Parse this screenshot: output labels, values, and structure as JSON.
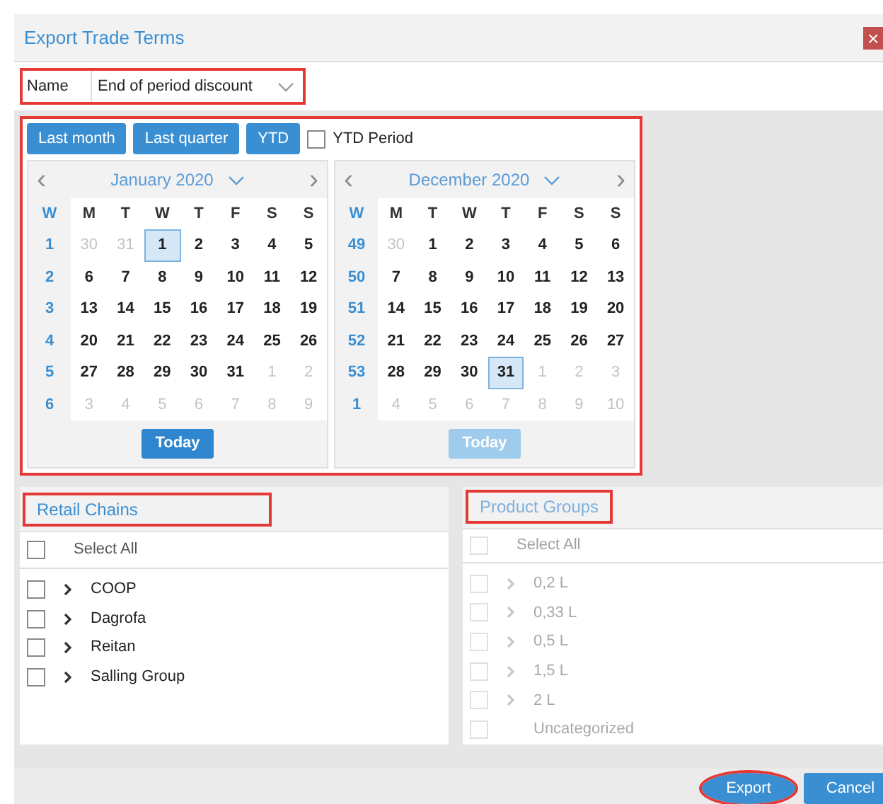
{
  "dialog": {
    "title": "Export Trade Terms",
    "close": "×"
  },
  "name_field": {
    "label": "Name",
    "value": "End of period discount",
    "annotated": true
  },
  "period": {
    "annotated": true,
    "buttons": [
      {
        "label": "Last month"
      },
      {
        "label": "Last quarter"
      },
      {
        "label": "YTD"
      }
    ],
    "ytd_period": {
      "label": "YTD Period",
      "checked": false
    },
    "calendars": [
      {
        "title": "January 2020",
        "prev": "‹",
        "next": "›",
        "week_header": "W",
        "weekdays": [
          "M",
          "T",
          "W",
          "T",
          "F",
          "S",
          "S"
        ],
        "today": {
          "label": "Today",
          "disabled": false
        },
        "weeks": [
          {
            "week": "1",
            "days": [
              {
                "d": "30",
                "other": true,
                "selected": false
              },
              {
                "d": "31",
                "other": true,
                "selected": false
              },
              {
                "d": "1",
                "other": false,
                "selected": true
              },
              {
                "d": "2",
                "other": false,
                "selected": false
              },
              {
                "d": "3",
                "other": false,
                "selected": false
              },
              {
                "d": "4",
                "other": false,
                "selected": false
              },
              {
                "d": "5",
                "other": false,
                "selected": false
              }
            ]
          },
          {
            "week": "2",
            "days": [
              {
                "d": "6",
                "other": false,
                "selected": false
              },
              {
                "d": "7",
                "other": false,
                "selected": false
              },
              {
                "d": "8",
                "other": false,
                "selected": false
              },
              {
                "d": "9",
                "other": false,
                "selected": false
              },
              {
                "d": "10",
                "other": false,
                "selected": false
              },
              {
                "d": "11",
                "other": false,
                "selected": false
              },
              {
                "d": "12",
                "other": false,
                "selected": false
              }
            ]
          },
          {
            "week": "3",
            "days": [
              {
                "d": "13",
                "other": false,
                "selected": false
              },
              {
                "d": "14",
                "other": false,
                "selected": false
              },
              {
                "d": "15",
                "other": false,
                "selected": false
              },
              {
                "d": "16",
                "other": false,
                "selected": false
              },
              {
                "d": "17",
                "other": false,
                "selected": false
              },
              {
                "d": "18",
                "other": false,
                "selected": false
              },
              {
                "d": "19",
                "other": false,
                "selected": false
              }
            ]
          },
          {
            "week": "4",
            "days": [
              {
                "d": "20",
                "other": false,
                "selected": false
              },
              {
                "d": "21",
                "other": false,
                "selected": false
              },
              {
                "d": "22",
                "other": false,
                "selected": false
              },
              {
                "d": "23",
                "other": false,
                "selected": false
              },
              {
                "d": "24",
                "other": false,
                "selected": false
              },
              {
                "d": "25",
                "other": false,
                "selected": false
              },
              {
                "d": "26",
                "other": false,
                "selected": false
              }
            ]
          },
          {
            "week": "5",
            "days": [
              {
                "d": "27",
                "other": false,
                "selected": false
              },
              {
                "d": "28",
                "other": false,
                "selected": false
              },
              {
                "d": "29",
                "other": false,
                "selected": false
              },
              {
                "d": "30",
                "other": false,
                "selected": false
              },
              {
                "d": "31",
                "other": false,
                "selected": false
              },
              {
                "d": "1",
                "other": true,
                "selected": false
              },
              {
                "d": "2",
                "other": true,
                "selected": false
              }
            ]
          },
          {
            "week": "6",
            "days": [
              {
                "d": "3",
                "other": true,
                "selected": false
              },
              {
                "d": "4",
                "other": true,
                "selected": false
              },
              {
                "d": "5",
                "other": true,
                "selected": false
              },
              {
                "d": "6",
                "other": true,
                "selected": false
              },
              {
                "d": "7",
                "other": true,
                "selected": false
              },
              {
                "d": "8",
                "other": true,
                "selected": false
              },
              {
                "d": "9",
                "other": true,
                "selected": false
              }
            ]
          }
        ]
      },
      {
        "title": "December 2020",
        "prev": "‹",
        "next": "›",
        "week_header": "W",
        "weekdays": [
          "M",
          "T",
          "W",
          "T",
          "F",
          "S",
          "S"
        ],
        "today": {
          "label": "Today",
          "disabled": true
        },
        "weeks": [
          {
            "week": "49",
            "days": [
              {
                "d": "30",
                "other": true,
                "selected": false
              },
              {
                "d": "1",
                "other": false,
                "selected": false
              },
              {
                "d": "2",
                "other": false,
                "selected": false
              },
              {
                "d": "3",
                "other": false,
                "selected": false
              },
              {
                "d": "4",
                "other": false,
                "selected": false
              },
              {
                "d": "5",
                "other": false,
                "selected": false
              },
              {
                "d": "6",
                "other": false,
                "selected": false
              }
            ]
          },
          {
            "week": "50",
            "days": [
              {
                "d": "7",
                "other": false,
                "selected": false
              },
              {
                "d": "8",
                "other": false,
                "selected": false
              },
              {
                "d": "9",
                "other": false,
                "selected": false
              },
              {
                "d": "10",
                "other": false,
                "selected": false
              },
              {
                "d": "11",
                "other": false,
                "selected": false
              },
              {
                "d": "12",
                "other": false,
                "selected": false
              },
              {
                "d": "13",
                "other": false,
                "selected": false
              }
            ]
          },
          {
            "week": "51",
            "days": [
              {
                "d": "14",
                "other": false,
                "selected": false
              },
              {
                "d": "15",
                "other": false,
                "selected": false
              },
              {
                "d": "16",
                "other": false,
                "selected": false
              },
              {
                "d": "17",
                "other": false,
                "selected": false
              },
              {
                "d": "18",
                "other": false,
                "selected": false
              },
              {
                "d": "19",
                "other": false,
                "selected": false
              },
              {
                "d": "20",
                "other": false,
                "selected": false
              }
            ]
          },
          {
            "week": "52",
            "days": [
              {
                "d": "21",
                "other": false,
                "selected": false
              },
              {
                "d": "22",
                "other": false,
                "selected": false
              },
              {
                "d": "23",
                "other": false,
                "selected": false
              },
              {
                "d": "24",
                "other": false,
                "selected": false
              },
              {
                "d": "25",
                "other": false,
                "selected": false
              },
              {
                "d": "26",
                "other": false,
                "selected": false
              },
              {
                "d": "27",
                "other": false,
                "selected": false
              }
            ]
          },
          {
            "week": "53",
            "days": [
              {
                "d": "28",
                "other": false,
                "selected": false
              },
              {
                "d": "29",
                "other": false,
                "selected": false
              },
              {
                "d": "30",
                "other": false,
                "selected": false
              },
              {
                "d": "31",
                "other": false,
                "selected": true
              },
              {
                "d": "1",
                "other": true,
                "selected": false
              },
              {
                "d": "2",
                "other": true,
                "selected": false
              },
              {
                "d": "3",
                "other": true,
                "selected": false
              }
            ]
          },
          {
            "week": "1",
            "days": [
              {
                "d": "4",
                "other": true,
                "selected": false
              },
              {
                "d": "5",
                "other": true,
                "selected": false
              },
              {
                "d": "6",
                "other": true,
                "selected": false
              },
              {
                "d": "7",
                "other": true,
                "selected": false
              },
              {
                "d": "8",
                "other": true,
                "selected": false
              },
              {
                "d": "9",
                "other": true,
                "selected": false
              },
              {
                "d": "10",
                "other": true,
                "selected": false
              }
            ]
          }
        ]
      }
    ]
  },
  "lists": [
    {
      "title": "Retail Chains",
      "annotated": true,
      "disabled": false,
      "select_all": {
        "label": "Select All",
        "checked": false
      },
      "items": [
        {
          "label": "COOP",
          "checked": false,
          "expandable": true
        },
        {
          "label": "Dagrofa",
          "checked": false,
          "expandable": true
        },
        {
          "label": "Reitan",
          "checked": false,
          "expandable": true
        },
        {
          "label": "Salling Group",
          "checked": false,
          "expandable": true
        }
      ]
    },
    {
      "title": "Product Groups",
      "annotated": true,
      "disabled": true,
      "select_all": {
        "label": "Select All",
        "checked": false
      },
      "items": [
        {
          "label": "0,2 L",
          "checked": false,
          "expandable": true
        },
        {
          "label": "0,33 L",
          "checked": false,
          "expandable": true
        },
        {
          "label": "0,5 L",
          "checked": false,
          "expandable": true
        },
        {
          "label": "1,5 L",
          "checked": false,
          "expandable": true
        },
        {
          "label": "2 L",
          "checked": false,
          "expandable": true
        },
        {
          "label": "Uncategorized",
          "checked": false,
          "expandable": false
        }
      ]
    }
  ],
  "footer": {
    "buttons": [
      {
        "label": "Export",
        "annotated": true
      },
      {
        "label": "Cancel",
        "annotated": false
      }
    ]
  }
}
